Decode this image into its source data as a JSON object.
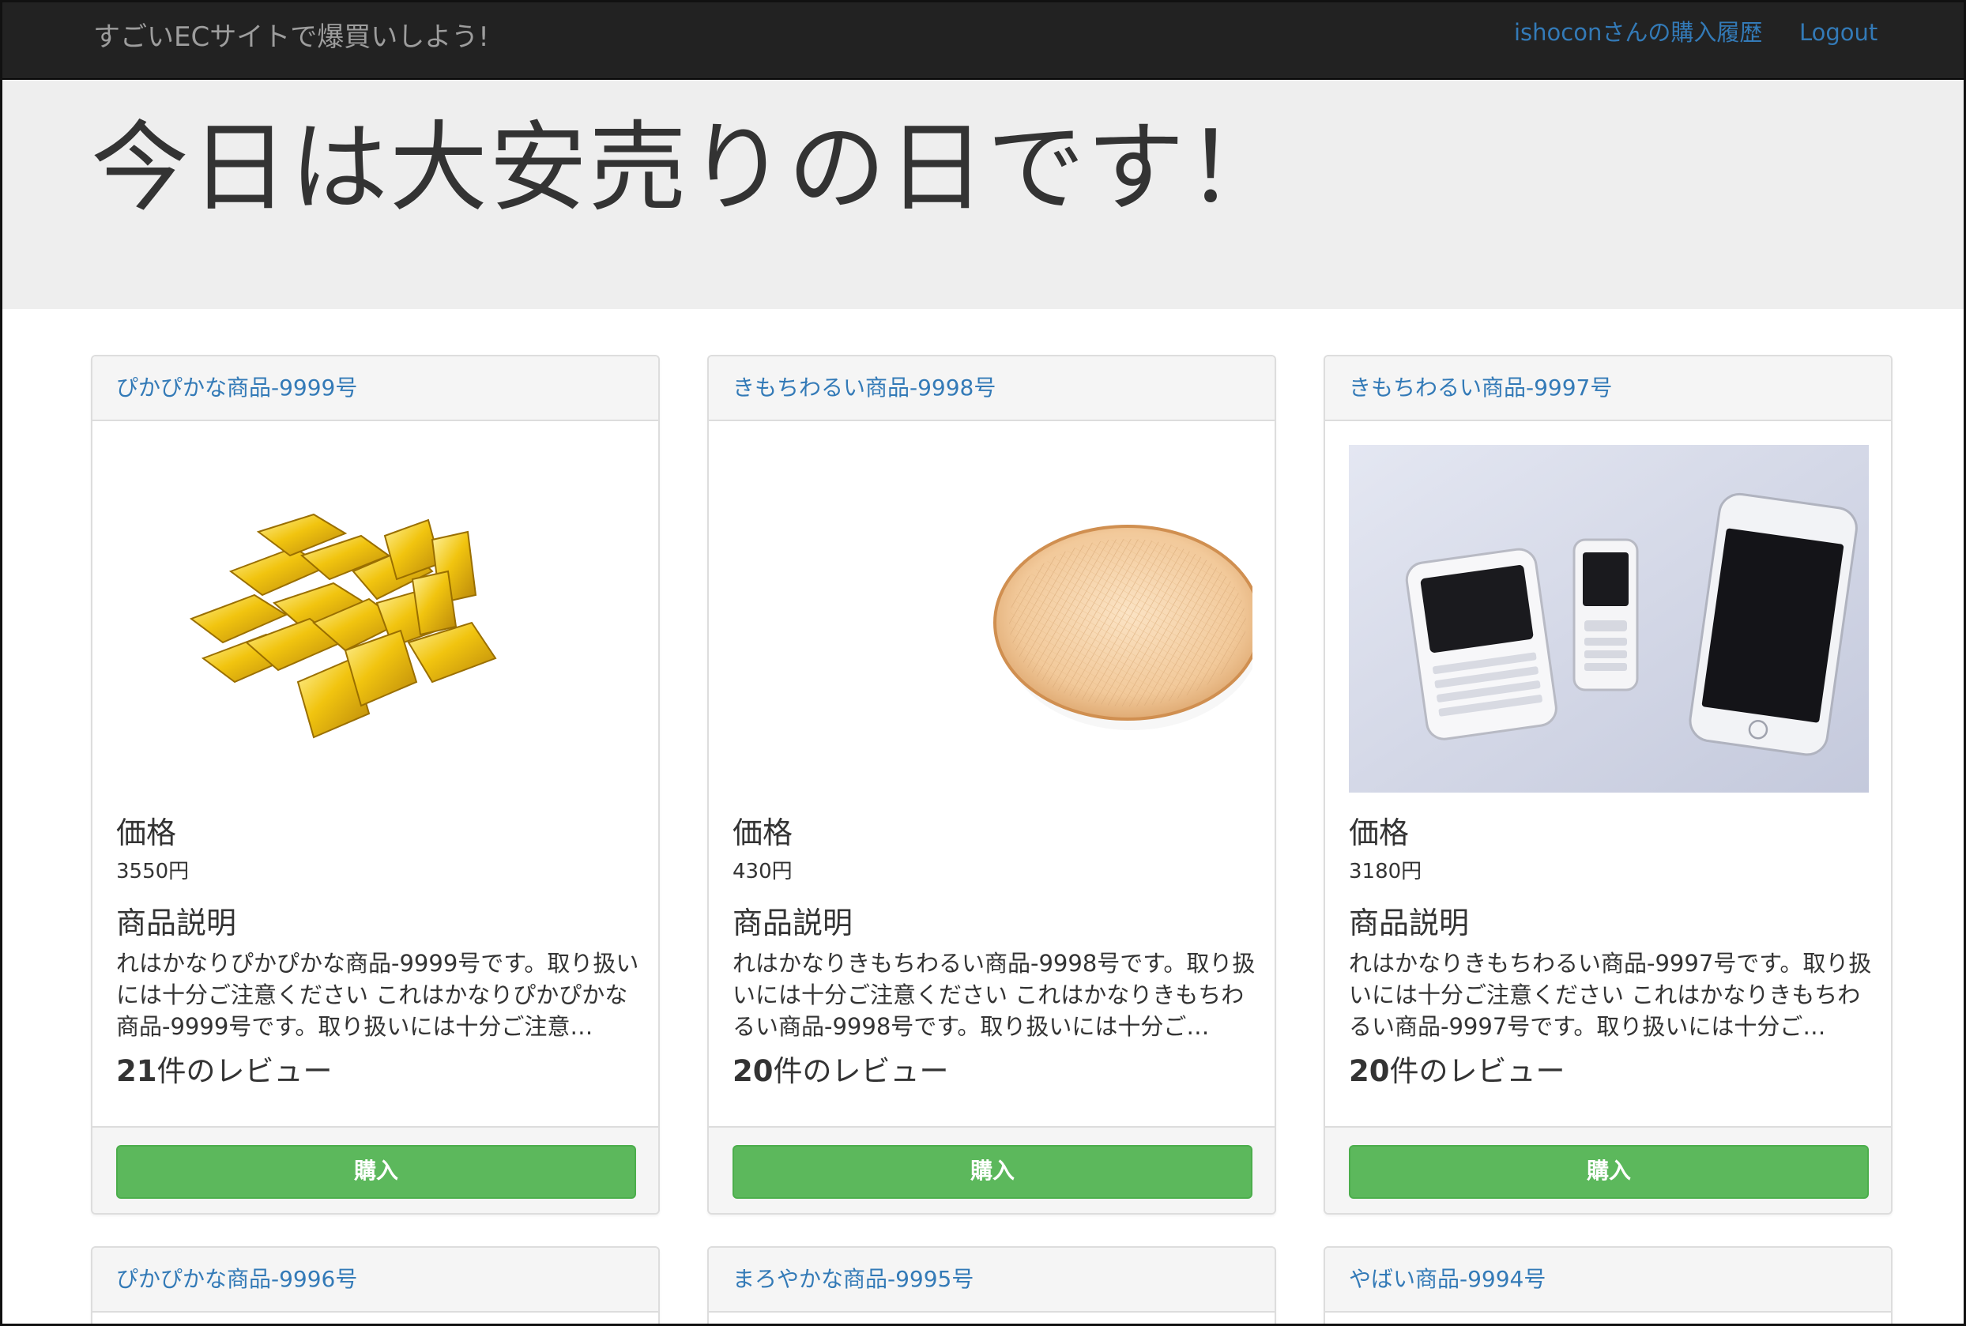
{
  "navbar": {
    "brand": "すごいECサイトで爆買いしよう!",
    "history_link": "ishoconさんの購入履歴",
    "logout_link": "Logout"
  },
  "jumbotron": {
    "title": "今日は大安売りの日です！"
  },
  "labels": {
    "price": "価格",
    "description": "商品説明",
    "reviews_suffix": "件のレビュー",
    "buy": "購入"
  },
  "products": [
    {
      "name": "ぴかぴかな商品-9999号",
      "image": "gold-bars",
      "price": "3550円",
      "description": "れはかなりぴかぴかな商品-9999号です。取り扱いには十分ご注意ください これはかなりぴかぴかな商品-9999号です。取り扱いには十分ご注意…",
      "review_count": "21"
    },
    {
      "name": "きもちわるい商品-9998号",
      "image": "bamboo-basket",
      "price": "430円",
      "description": "れはかなりきもちわるい商品-9998号です。取り扱いには十分ご注意ください これはかなりきもちわるい商品-9998号です。取り扱いには十分ご…",
      "review_count": "20"
    },
    {
      "name": "きもちわるい商品-9997号",
      "image": "mobile-phones",
      "price": "3180円",
      "description": "れはかなりきもちわるい商品-9997号です。取り扱いには十分ご注意ください これはかなりきもちわるい商品-9997号です。取り扱いには十分ご…",
      "review_count": "20"
    },
    {
      "name": "ぴかぴかな商品-9996号"
    },
    {
      "name": "まろやかな商品-9995号"
    },
    {
      "name": "やばい商品-9994号"
    }
  ],
  "colors": {
    "navbar_bg": "#222222",
    "link": "#337ab7",
    "button": "#5cb85c",
    "jumbotron_bg": "#eeeeee"
  }
}
